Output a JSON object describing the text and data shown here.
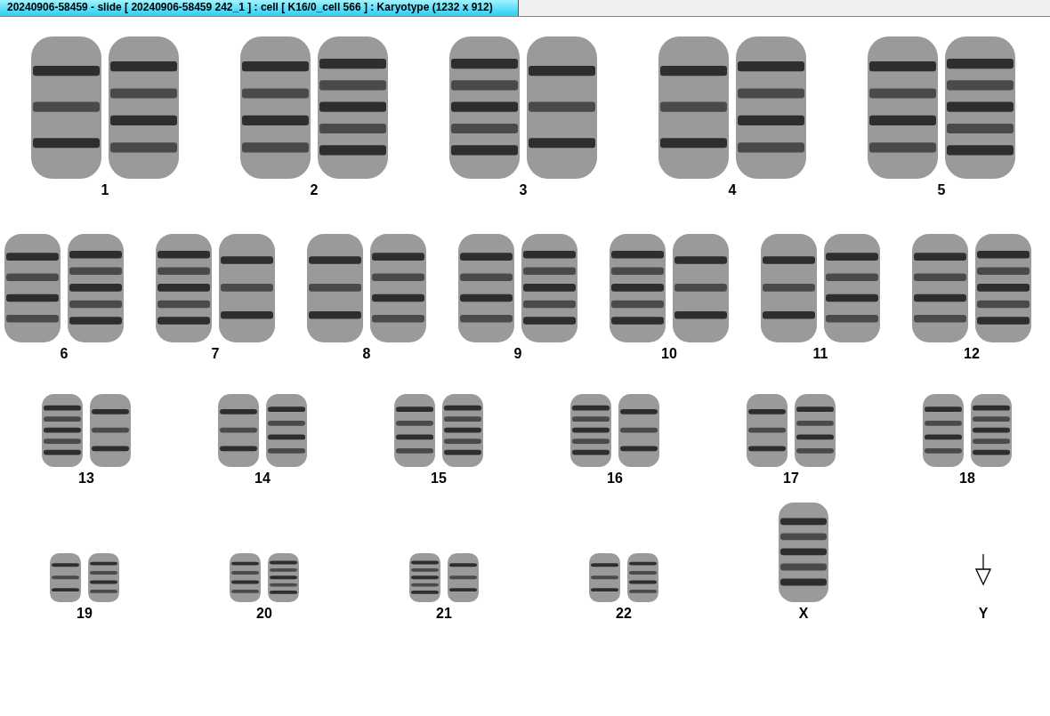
{
  "window": {
    "title": "20240906-58459 - slide [ 20240906-58459 242_1 ] : cell [ K16/0_cell 566 ] : Karyotype  (1232 x 912)"
  },
  "rows": [
    {
      "groups": [
        {
          "label": "1",
          "kind": "pair"
        },
        {
          "label": "2",
          "kind": "pair"
        },
        {
          "label": "3",
          "kind": "pair"
        },
        {
          "label": "4",
          "kind": "pair"
        },
        {
          "label": "5",
          "kind": "pair"
        }
      ]
    },
    {
      "groups": [
        {
          "label": "6",
          "kind": "pair"
        },
        {
          "label": "7",
          "kind": "pair"
        },
        {
          "label": "8",
          "kind": "pair"
        },
        {
          "label": "9",
          "kind": "pair"
        },
        {
          "label": "10",
          "kind": "pair"
        },
        {
          "label": "11",
          "kind": "pair"
        },
        {
          "label": "12",
          "kind": "pair"
        }
      ]
    },
    {
      "groups": [
        {
          "label": "13",
          "kind": "pair"
        },
        {
          "label": "14",
          "kind": "pair"
        },
        {
          "label": "15",
          "kind": "pair"
        },
        {
          "label": "16",
          "kind": "pair"
        },
        {
          "label": "17",
          "kind": "pair"
        },
        {
          "label": "18",
          "kind": "pair"
        }
      ]
    },
    {
      "groups": [
        {
          "label": "19",
          "kind": "pair"
        },
        {
          "label": "20",
          "kind": "pair"
        },
        {
          "label": "21",
          "kind": "pair"
        },
        {
          "label": "22",
          "kind": "pair"
        },
        {
          "label": "X",
          "kind": "single"
        },
        {
          "label": "Y",
          "kind": "marker"
        }
      ]
    }
  ]
}
